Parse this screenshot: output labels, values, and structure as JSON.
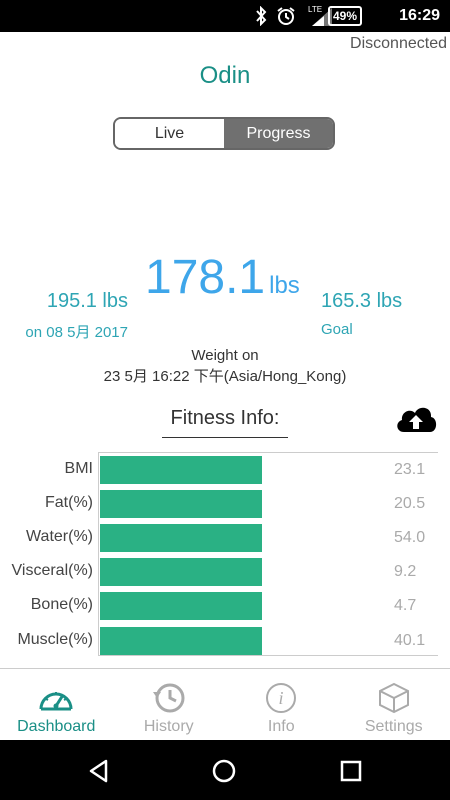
{
  "status_bar": {
    "time": "16:29",
    "battery": "49%",
    "network": "LTE",
    "icons": [
      "bluetooth-icon",
      "alarm-icon",
      "signal-icon",
      "battery-icon"
    ]
  },
  "connection_status": "Disconnected",
  "device_name": "Odin",
  "toggle": {
    "live_label": "Live",
    "progress_label": "Progress",
    "selected": "Progress"
  },
  "weight": {
    "current_value": "178.1",
    "current_unit": "lbs",
    "start_value": "195.1 lbs",
    "start_caption": "on 08 5月 2017",
    "goal_value": "165.3 lbs",
    "goal_caption": "Goal",
    "weighed_label": "Weight on",
    "weighed_time": "23 5月 16:22 下午(Asia/Hong_Kong)"
  },
  "fitness": {
    "title": "Fitness Info:",
    "upload_icon": "cloud-upload-icon",
    "rows": [
      {
        "label": "BMI",
        "value": "23.1"
      },
      {
        "label": "Fat(%)",
        "value": "20.5"
      },
      {
        "label": "Water(%)",
        "value": "54.0"
      },
      {
        "label": "Visceral(%)",
        "value": "9.2"
      },
      {
        "label": "Bone(%)",
        "value": "4.7"
      },
      {
        "label": "Muscle(%)",
        "value": "40.1"
      }
    ]
  },
  "bottom_nav": {
    "tabs": [
      {
        "label": "Dashboard",
        "icon": "dashboard-gauge-icon",
        "active": true
      },
      {
        "label": "History",
        "icon": "history-clock-icon",
        "active": false
      },
      {
        "label": "Info",
        "icon": "info-icon",
        "active": false
      },
      {
        "label": "Settings",
        "icon": "settings-cube-icon",
        "active": false
      }
    ]
  },
  "colors": {
    "accent": "#1a8f86",
    "weight_blue": "#3ea6ea",
    "bar_green": "#2ab184",
    "side_teal": "#2ea5b4"
  }
}
